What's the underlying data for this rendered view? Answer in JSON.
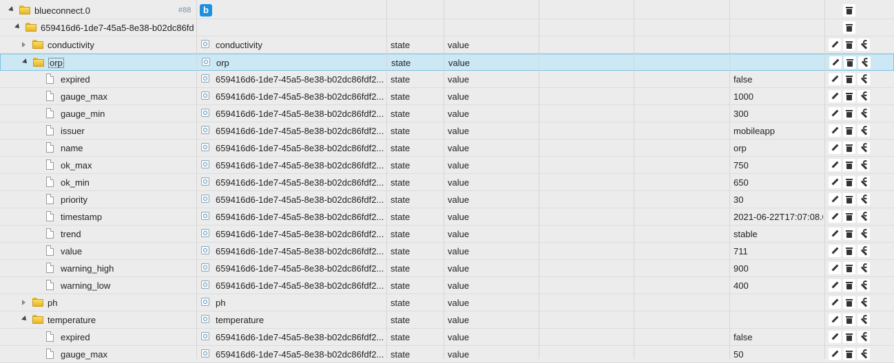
{
  "root": {
    "name": "blueconnect.0",
    "badge": "#88",
    "adapter_letter": "b"
  },
  "device": {
    "name": "659416d6-1de7-45a5-8e38-b02dc86fd"
  },
  "rows": [
    {
      "indent": 1,
      "expand": "closed",
      "kind": "folder",
      "id": "conductivity",
      "name": "conductivity",
      "type": "state",
      "role": "value",
      "value": ""
    },
    {
      "indent": 1,
      "expand": "open",
      "kind": "folder",
      "id": "orp",
      "name": "orp",
      "type": "state",
      "role": "value",
      "value": "",
      "selected": true
    },
    {
      "indent": 2,
      "kind": "file",
      "id": "expired",
      "name": "659416d6-1de7-45a5-8e38-b02dc86fdf2...",
      "type": "state",
      "role": "value",
      "value": "false"
    },
    {
      "indent": 2,
      "kind": "file",
      "id": "gauge_max",
      "name": "659416d6-1de7-45a5-8e38-b02dc86fdf2...",
      "type": "state",
      "role": "value",
      "value": "1000"
    },
    {
      "indent": 2,
      "kind": "file",
      "id": "gauge_min",
      "name": "659416d6-1de7-45a5-8e38-b02dc86fdf2...",
      "type": "state",
      "role": "value",
      "value": "300"
    },
    {
      "indent": 2,
      "kind": "file",
      "id": "issuer",
      "name": "659416d6-1de7-45a5-8e38-b02dc86fdf2...",
      "type": "state",
      "role": "value",
      "value": "mobileapp"
    },
    {
      "indent": 2,
      "kind": "file",
      "id": "name",
      "name": "659416d6-1de7-45a5-8e38-b02dc86fdf2...",
      "type": "state",
      "role": "value",
      "value": "orp"
    },
    {
      "indent": 2,
      "kind": "file",
      "id": "ok_max",
      "name": "659416d6-1de7-45a5-8e38-b02dc86fdf2...",
      "type": "state",
      "role": "value",
      "value": "750"
    },
    {
      "indent": 2,
      "kind": "file",
      "id": "ok_min",
      "name": "659416d6-1de7-45a5-8e38-b02dc86fdf2...",
      "type": "state",
      "role": "value",
      "value": "650"
    },
    {
      "indent": 2,
      "kind": "file",
      "id": "priority",
      "name": "659416d6-1de7-45a5-8e38-b02dc86fdf2...",
      "type": "state",
      "role": "value",
      "value": "30"
    },
    {
      "indent": 2,
      "kind": "file",
      "id": "timestamp",
      "name": "659416d6-1de7-45a5-8e38-b02dc86fdf2...",
      "type": "state",
      "role": "value",
      "value": "2021-06-22T17:07:08.0"
    },
    {
      "indent": 2,
      "kind": "file",
      "id": "trend",
      "name": "659416d6-1de7-45a5-8e38-b02dc86fdf2...",
      "type": "state",
      "role": "value",
      "value": "stable"
    },
    {
      "indent": 2,
      "kind": "file",
      "id": "value",
      "name": "659416d6-1de7-45a5-8e38-b02dc86fdf2...",
      "type": "state",
      "role": "value",
      "value": "711"
    },
    {
      "indent": 2,
      "kind": "file",
      "id": "warning_high",
      "name": "659416d6-1de7-45a5-8e38-b02dc86fdf2...",
      "type": "state",
      "role": "value",
      "value": "900"
    },
    {
      "indent": 2,
      "kind": "file",
      "id": "warning_low",
      "name": "659416d6-1de7-45a5-8e38-b02dc86fdf2...",
      "type": "state",
      "role": "value",
      "value": "400"
    },
    {
      "indent": 1,
      "expand": "closed",
      "kind": "folder",
      "id": "ph",
      "name": "ph",
      "type": "state",
      "role": "value",
      "value": ""
    },
    {
      "indent": 1,
      "expand": "open",
      "kind": "folder",
      "id": "temperature",
      "name": "temperature",
      "type": "state",
      "role": "value",
      "value": ""
    },
    {
      "indent": 2,
      "kind": "file",
      "id": "expired",
      "name": "659416d6-1de7-45a5-8e38-b02dc86fdf2...",
      "type": "state",
      "role": "value",
      "value": "false"
    },
    {
      "indent": 2,
      "kind": "file",
      "id": "gauge_max",
      "name": "659416d6-1de7-45a5-8e38-b02dc86fdf2...",
      "type": "state",
      "role": "value",
      "value": "50"
    }
  ]
}
